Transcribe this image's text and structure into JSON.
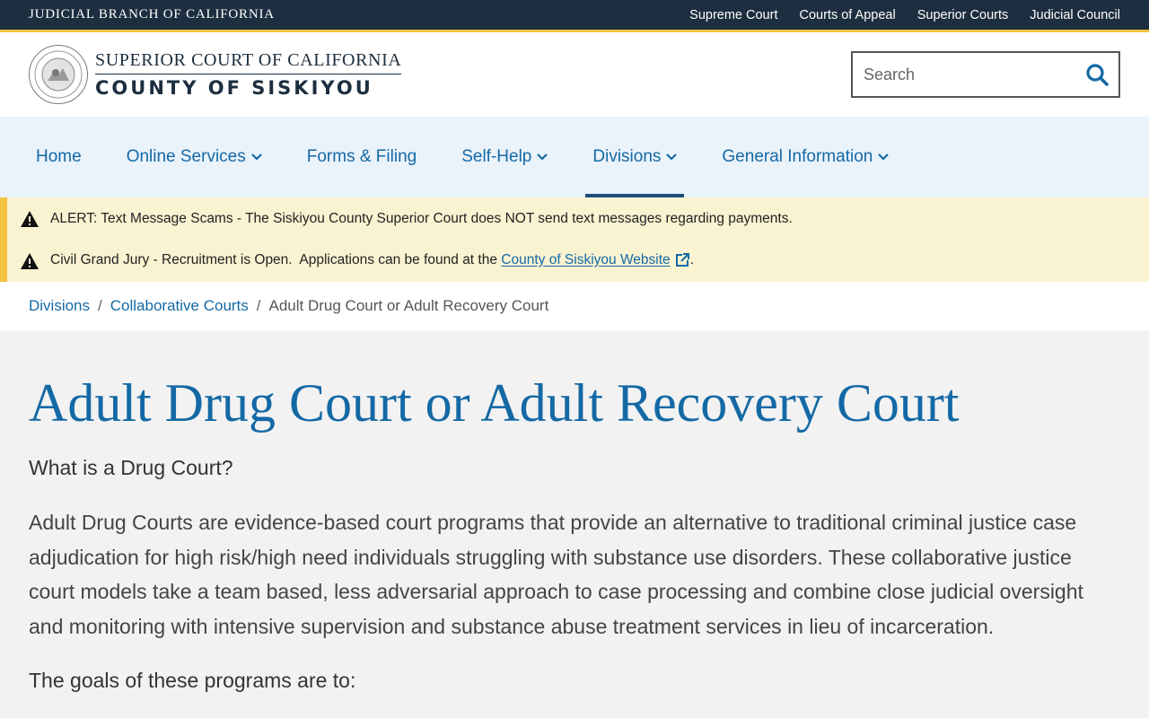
{
  "topbar": {
    "branch": "JUDICIAL BRANCH OF CALIFORNIA",
    "links": [
      "Supreme Court",
      "Courts of Appeal",
      "Superior Courts",
      "Judicial Council"
    ]
  },
  "header": {
    "logo_line1": "SUPERIOR COURT OF CALIFORNIA",
    "logo_line2": "COUNTY OF SISKIYOU",
    "search_placeholder": "Search"
  },
  "nav": {
    "items": [
      {
        "label": "Home",
        "dropdown": false
      },
      {
        "label": "Online Services",
        "dropdown": true
      },
      {
        "label": "Forms & Filing",
        "dropdown": false
      },
      {
        "label": "Self-Help",
        "dropdown": true
      },
      {
        "label": "Divisions",
        "dropdown": true,
        "active": true
      },
      {
        "label": "General Information",
        "dropdown": true
      }
    ]
  },
  "alerts": {
    "alert1": "ALERT: Text Message Scams - The Siskiyou County Superior Court does NOT send text messages regarding payments.",
    "alert2_prefix": "Civil Grand Jury - Recruitment is Open.  Applications can be found at the ",
    "alert2_link": "County of Siskiyou Website",
    "alert2_suffix": "."
  },
  "breadcrumb": {
    "items": [
      "Divisions",
      "Collaborative Courts"
    ],
    "separator": "/",
    "current": "Adult Drug Court or Adult Recovery Court"
  },
  "content": {
    "title": "Adult Drug Court or Adult Recovery Court",
    "subhead": "What is a Drug Court?",
    "paragraph": "Adult Drug Courts are evidence-based court programs that provide an alternative to traditional criminal justice case adjudication for high risk/high need individuals struggling with substance use disorders. These collaborative justice court models take a team based, less adversarial approach to case processing and combine close judicial oversight and monitoring with intensive supervision and substance abuse treatment services in lieu of incarceration.",
    "goals": "The goals of these programs are to:"
  },
  "colors": {
    "topbar_bg": "#1c2e3f",
    "accent_gold": "#f2c33f",
    "link_blue": "#1469a5",
    "nav_bg": "#eaf2fa",
    "alert_bg": "#faf3d2"
  }
}
